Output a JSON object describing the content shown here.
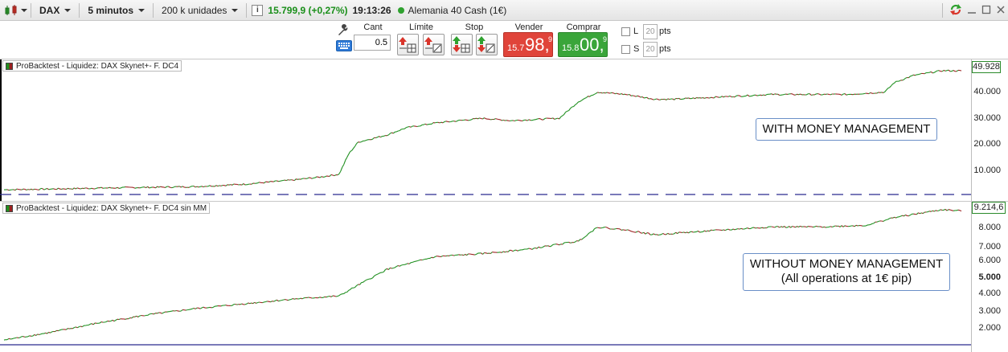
{
  "toolbar": {
    "instrument": "DAX",
    "timeframe": "5 minutos",
    "units": "200 k unidades",
    "info": "i",
    "price": "15.799,9 (+0,27%)",
    "time": "19:13:26",
    "market": "Alemania 40 Cash (1€)"
  },
  "order": {
    "qty_label": "Cant",
    "qty_value": "0.5",
    "limit_label": "Límite",
    "stop_label": "Stop",
    "sell_label": "Vender",
    "buy_label": "Comprar",
    "sell_small": "15.7",
    "sell_big": "98,",
    "sell_sup": "9",
    "buy_small": "15.8",
    "buy_big": "00,",
    "buy_sup": "9",
    "l_label": "L",
    "s_label": "S",
    "l_pts": "20",
    "s_pts": "20",
    "pts_label": "pts"
  },
  "colors": {
    "up": "#1f8f1f",
    "down": "#9b1f1f",
    "baseline": "#2b2b8f",
    "annot_border": "#6a8fc7"
  },
  "chart_data": [
    {
      "type": "line",
      "title": "ProBacktest - Liquidez: DAX Skynet+-  F. DC4",
      "annotation": "WITH MONEY MANAGEMENT",
      "last_value": "49.928",
      "yticks": [
        "40.000",
        "30.000",
        "20.000",
        "10.000"
      ],
      "ylim": [
        -2000,
        52000
      ],
      "series": [
        {
          "points": [
            [
              0,
              0
            ],
            [
              0.05,
              300
            ],
            [
              0.1,
              700
            ],
            [
              0.15,
              1000
            ],
            [
              0.2,
              1300
            ],
            [
              0.25,
              2300
            ],
            [
              0.3,
              4000
            ],
            [
              0.33,
              5300
            ],
            [
              0.35,
              6500
            ],
            [
              0.36,
              15000
            ],
            [
              0.37,
              20000
            ],
            [
              0.4,
              23000
            ],
            [
              0.42,
              26000
            ],
            [
              0.45,
              28000
            ],
            [
              0.5,
              30000
            ],
            [
              0.53,
              29000
            ],
            [
              0.58,
              30000
            ],
            [
              0.6,
              37000
            ],
            [
              0.62,
              41000
            ],
            [
              0.65,
              40000
            ],
            [
              0.68,
              38000
            ],
            [
              0.7,
              38000
            ],
            [
              0.75,
              39000
            ],
            [
              0.8,
              40000
            ],
            [
              0.85,
              40000
            ],
            [
              0.88,
              40000
            ],
            [
              0.92,
              41000
            ],
            [
              0.93,
              45000
            ],
            [
              0.95,
              48000
            ],
            [
              0.98,
              50000
            ],
            [
              1,
              49928
            ]
          ]
        }
      ]
    },
    {
      "type": "line",
      "title": "ProBacktest - Liquidez: DAX Skynet+-  F. DC4 sin MM",
      "annotation": [
        "WITHOUT MONEY MANAGEMENT",
        "(All operations at 1€ pip)"
      ],
      "last_value": "9.214,6",
      "yticks": [
        "8.000",
        "7.000",
        "6.000",
        "5.000",
        "4.000",
        "3.000",
        "2.000"
      ],
      "bold_tick": "5.000",
      "ylim": [
        800,
        9500
      ],
      "series": [
        {
          "points": [
            [
              0,
              1000
            ],
            [
              0.05,
              1500
            ],
            [
              0.1,
              2100
            ],
            [
              0.15,
              2600
            ],
            [
              0.2,
              3000
            ],
            [
              0.25,
              3300
            ],
            [
              0.3,
              3600
            ],
            [
              0.35,
              3800
            ],
            [
              0.37,
              4500
            ],
            [
              0.4,
              5500
            ],
            [
              0.45,
              6300
            ],
            [
              0.5,
              6500
            ],
            [
              0.55,
              6800
            ],
            [
              0.58,
              7100
            ],
            [
              0.6,
              7300
            ],
            [
              0.62,
              8200
            ],
            [
              0.65,
              8000
            ],
            [
              0.68,
              7700
            ],
            [
              0.7,
              7800
            ],
            [
              0.75,
              8000
            ],
            [
              0.8,
              8200
            ],
            [
              0.85,
              8200
            ],
            [
              0.9,
              8300
            ],
            [
              0.93,
              8800
            ],
            [
              0.96,
              9100
            ],
            [
              0.98,
              9300
            ],
            [
              1,
              9214.6
            ]
          ]
        }
      ]
    }
  ]
}
